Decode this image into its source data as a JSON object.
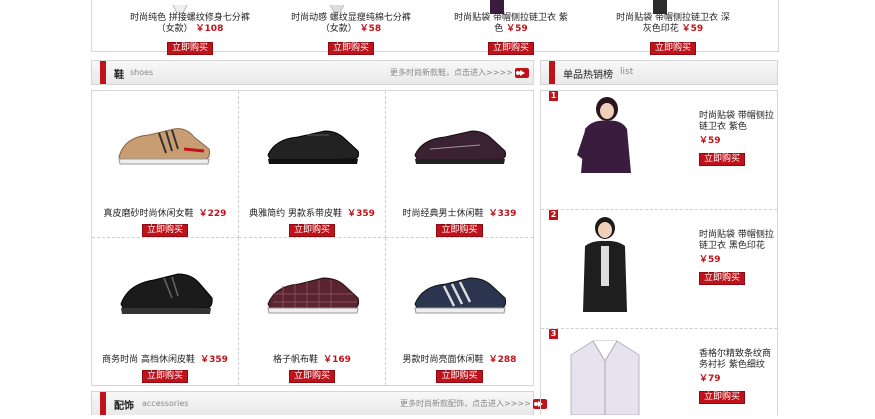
{
  "top_row": [
    {
      "line1": "时尚纯色 拼接螺纹修身七分裤",
      "line2": "（女款）",
      "price": "￥108",
      "buy": "立即购买"
    },
    {
      "line1": "时尚动感 螺纹显瘦纯棉七分裤",
      "line2": "（女款）",
      "price": "￥58",
      "buy": "立即购买"
    },
    {
      "line1": "时尚贴袋 带帽侧拉链卫衣 紫",
      "line2": "色",
      "price": "￥59",
      "buy": "立即购买"
    },
    {
      "line1": "时尚贴袋 带帽侧拉链卫衣 深",
      "line2": "灰色印花",
      "price": "￥59",
      "buy": "立即购买"
    }
  ],
  "shoes_section": {
    "title": "鞋",
    "subtitle": "shoes",
    "more": "更多时尚新款鞋，点击进入>>>>",
    "products": [
      {
        "name": "真皮磨砂时尚休闲女鞋",
        "price": "￥229",
        "buy": "立即购买"
      },
      {
        "name": "典雅简约 男款系带皮鞋",
        "price": "￥359",
        "buy": "立即购买"
      },
      {
        "name": "时尚经典男士休闲鞋",
        "price": "￥339",
        "buy": "立即购买"
      },
      {
        "name": "商务时尚 高档休闲皮鞋",
        "price": "￥359",
        "buy": "立即购买"
      },
      {
        "name": "格子帆布鞋",
        "price": "￥169",
        "buy": "立即购买"
      },
      {
        "name": "男款时尚亮面休闲鞋",
        "price": "￥288",
        "buy": "立即购买"
      }
    ]
  },
  "bestseller": {
    "title": "单品热销榜",
    "subtitle": "list",
    "items": [
      {
        "rank": "1",
        "name": "时尚贴袋 带帽侧拉链卫衣 紫色",
        "price": "￥59",
        "buy": "立即购买"
      },
      {
        "rank": "2",
        "name": "时尚贴袋 带帽侧拉链卫衣 黑色印花",
        "price": "￥59",
        "buy": "立即购买"
      },
      {
        "rank": "3",
        "name": "香格尔精致条纹商务衬衫 紫色细纹",
        "price": "￥79",
        "buy": "立即购买"
      }
    ]
  },
  "accessories_section": {
    "title": "配饰",
    "subtitle": "accessories",
    "more": "更多时尚新款配饰，点击进入>>>>"
  },
  "colors": {
    "accent": "#c0121a"
  }
}
